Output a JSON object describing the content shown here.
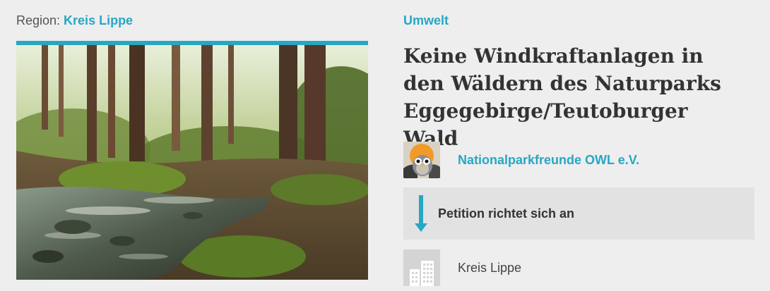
{
  "region": {
    "label": "Region:",
    "name": "Kreis Lippe"
  },
  "petition": {
    "category": "Umwelt",
    "title": "Keine Windkraftanlagen in den Wäldern des Naturparks Eggegebirge/Teutoburger Wald",
    "author": "Nationalparkfreunde OWL e.V.",
    "addressee_label": "Petition richtet sich an",
    "addressee": "Kreis Lippe"
  },
  "colors": {
    "accent": "#26a7c4",
    "background": "#eeeeee",
    "box": "#e2e2e2",
    "text": "#333333"
  },
  "icons": {
    "arrow": "arrow-down-icon",
    "building": "building-icon",
    "avatar": "owl-logo"
  }
}
